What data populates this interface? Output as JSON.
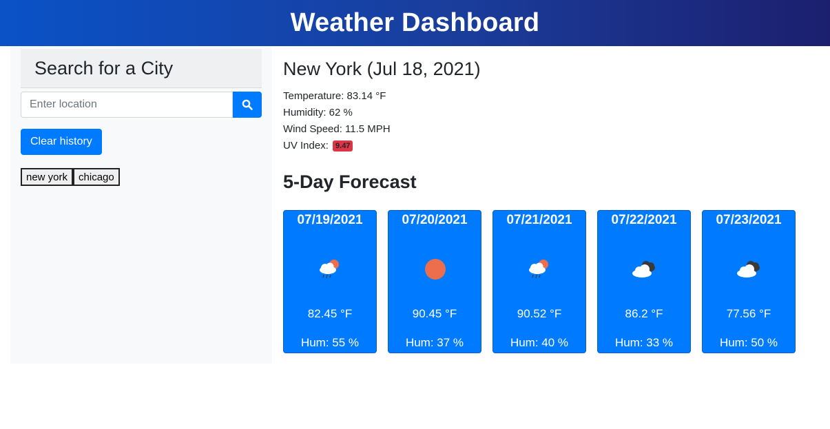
{
  "header": {
    "title": "Weather Dashboard"
  },
  "sidebar": {
    "search_heading": "Search for a City",
    "search_placeholder": "Enter location",
    "search_icon": "search-icon",
    "clear_label": "Clear history",
    "history": [
      "new york",
      "chicago"
    ]
  },
  "current": {
    "title": "New York (Jul 18, 2021)",
    "temperature": "Temperature: 83.14 °F",
    "humidity": "Humidity: 62 %",
    "wind": "Wind Speed: 11.5 MPH",
    "uv_label": "UV Index:",
    "uv_value": "9.47",
    "uv_color": "#dc3545"
  },
  "forecast": {
    "title": "5-Day Forecast",
    "days": [
      {
        "date": "07/19/2021",
        "icon": "rain-sun-icon",
        "temp": "82.45 °F",
        "hum": "Hum: 55 %"
      },
      {
        "date": "07/20/2021",
        "icon": "sun-icon",
        "temp": "90.45 °F",
        "hum": "Hum: 37 %"
      },
      {
        "date": "07/21/2021",
        "icon": "rain-sun-icon",
        "temp": "90.52 °F",
        "hum": "Hum: 40 %"
      },
      {
        "date": "07/22/2021",
        "icon": "broken-clouds-icon",
        "temp": "86.2 °F",
        "hum": "Hum: 33 %"
      },
      {
        "date": "07/23/2021",
        "icon": "broken-clouds-icon",
        "temp": "77.56 °F",
        "hum": "Hum: 50 %"
      }
    ]
  },
  "colors": {
    "accent": "#007bff",
    "sun": "#ec6e4c"
  }
}
